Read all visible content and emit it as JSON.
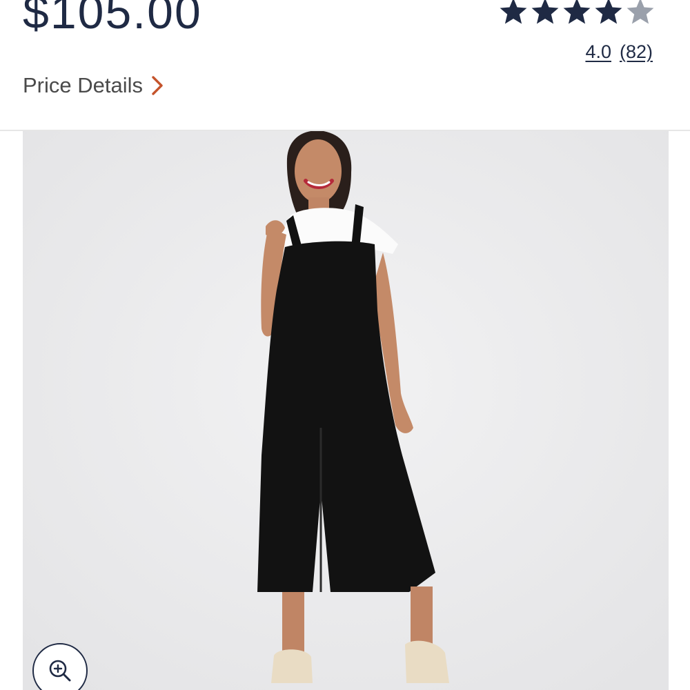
{
  "product": {
    "price": "$105.00",
    "price_details_label": "Price Details"
  },
  "rating": {
    "value": 4.0,
    "max": 5,
    "score_label": "4.0",
    "count_label": "(82)"
  },
  "image": {
    "zoom_icon": "zoom-in-icon"
  },
  "colors": {
    "primary_text": "#1f2a44",
    "secondary_text": "#4a4a4a",
    "accent_chevron": "#c4532b",
    "star_filled": "#1f2a44",
    "star_empty": "#9aa0ab",
    "image_background": "#ececed"
  }
}
